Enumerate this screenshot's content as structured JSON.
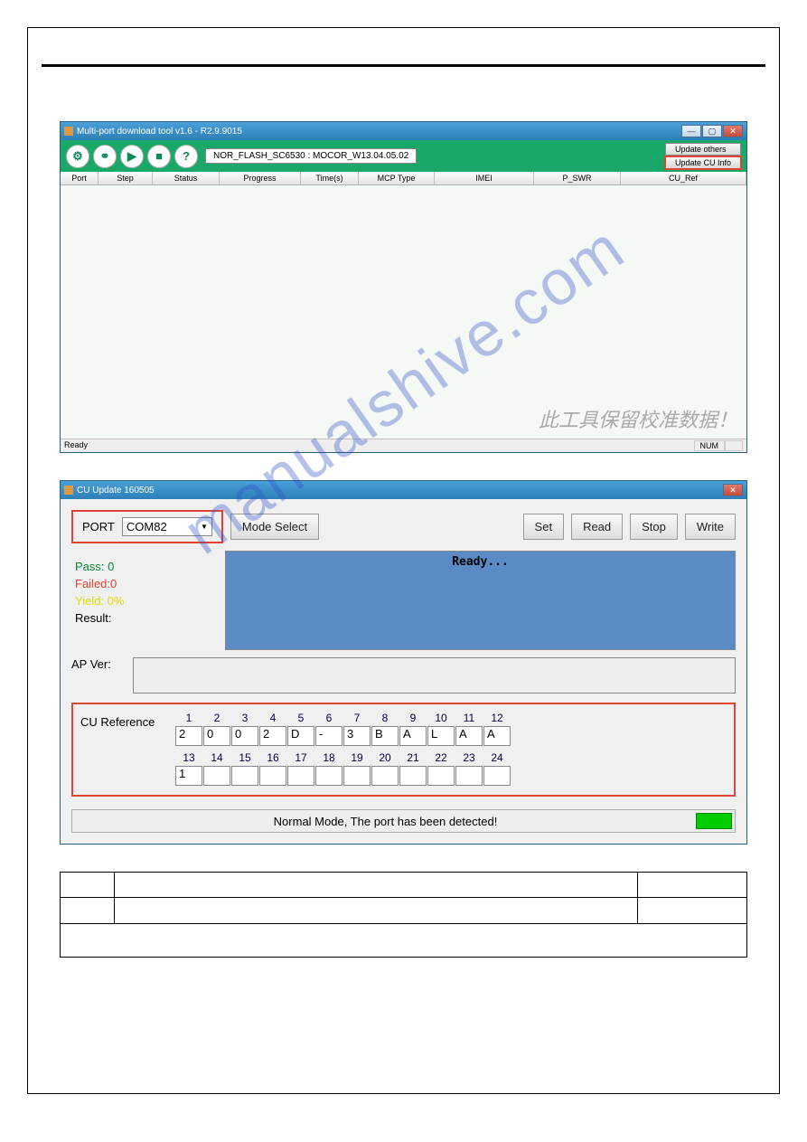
{
  "watermark": "manualshive.com",
  "window1": {
    "title": "Multi-port download tool v1.6 - R2.9.9015",
    "flash_label": "NOR_FLASH_SC6530 : MOCOR_W13.04.05.02",
    "btn_update_others": "Update others",
    "btn_update_cu": "Update CU Info",
    "columns": [
      "Port",
      "Step",
      "Status",
      "Progress",
      "Time(s)",
      "MCP Type",
      "IMEI",
      "P_SWR",
      "CU_Ref"
    ],
    "chinese_overlay": "此工具保留校准数据！",
    "status_ready": "Ready",
    "status_num": "NUM"
  },
  "window2": {
    "title": "CU Update 160505",
    "port_label": "PORT",
    "port_value": "COM82",
    "btn_mode": "Mode Select",
    "btn_set": "Set",
    "btn_read": "Read",
    "btn_stop": "Stop",
    "btn_write": "Write",
    "pass": "Pass:  0",
    "failed": "Failed:0",
    "yield": "Yield: 0%",
    "result": "Result:",
    "ready": "Ready...",
    "apver": "AP Ver:",
    "cu_ref_label": "CU Reference",
    "cu_headers_1": [
      "1",
      "2",
      "3",
      "4",
      "5",
      "6",
      "7",
      "8",
      "9",
      "10",
      "11",
      "12"
    ],
    "cu_values_1": [
      "2",
      "0",
      "0",
      "2",
      "D",
      "-",
      "3",
      "B",
      "A",
      "L",
      "A",
      "A"
    ],
    "cu_headers_2": [
      "13",
      "14",
      "15",
      "16",
      "17",
      "18",
      "19",
      "20",
      "21",
      "22",
      "23",
      "24"
    ],
    "cu_values_2": [
      "1",
      "",
      "",
      "",
      "",
      "",
      "",
      "",
      "",
      "",
      "",
      ""
    ],
    "detected": "Normal Mode, The port has been detected!"
  }
}
